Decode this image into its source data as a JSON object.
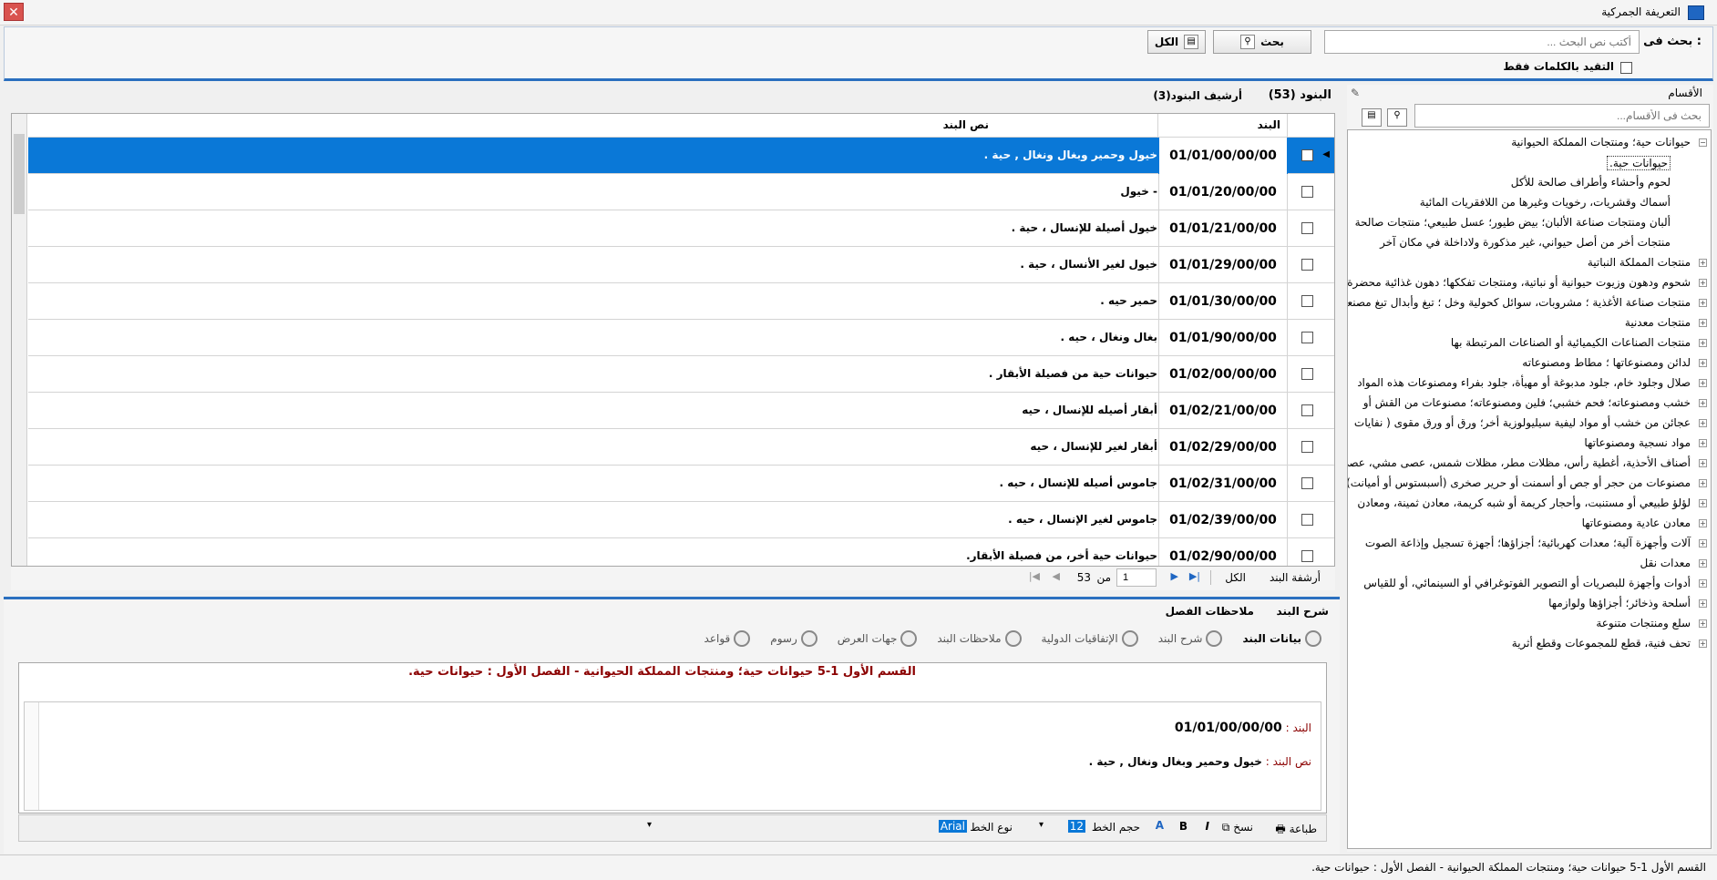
{
  "window": {
    "title": "التعريفة الجمركية",
    "close_label": "✕"
  },
  "search": {
    "label": "بحث فى :",
    "placeholder": "أكتب نص البحث ...",
    "search_btn": "بحث",
    "all_btn": "الكل",
    "exact_words_label": "التقيد بالكلمات فقط"
  },
  "categories": {
    "title": "الأقسام",
    "search_placeholder": "بحث فى الأقسام...",
    "items": [
      {
        "label": "حيوانات حية؛ ومنتجات المملكة الحيوانية",
        "expanded": true,
        "level": 0
      },
      {
        "label": "حيوانات حية.",
        "level": 1
      },
      {
        "label": "لحوم وأحشاء وأطراف صالحة للأكل",
        "level": 1
      },
      {
        "label": "أسماك وقشريات، رخويات وغيرها من اللافقريات المائية",
        "level": 1
      },
      {
        "label": "ألبان ومنتجات صناعة الألبان؛ بيض طيور؛ عسل طبيعي؛ منتجات صالحة",
        "level": 1
      },
      {
        "label": "منتجات أخر من أصل حيواني، غير مذكورة ولاداخلة في مكان آخر",
        "level": 1
      },
      {
        "label": "منتجات المملكة النباتية",
        "level": 0
      },
      {
        "label": "شحوم ودهون وزيوت حيوانية أو نباتية، ومنتجات تفككها؛ دهون غذائية محضرة",
        "level": 0
      },
      {
        "label": "منتجات صناعة الأغذية ؛ مشروبات، سوائل كحولية وخل ؛ تبغ وأبدال تبغ مصنعة",
        "level": 0
      },
      {
        "label": "منتجات معدنية",
        "level": 0
      },
      {
        "label": "منتجات الصناعات الكيميائية أو الصناعات المرتبطة بها",
        "level": 0
      },
      {
        "label": "لدائن ومصنوعاتها ؛ مطاط ومصنوعاته",
        "level": 0
      },
      {
        "label": "صلال وجلود خام، جلود مدبوغة أو مهيأة، جلود بفراء ومصنوعات هذه المواد",
        "level": 0
      },
      {
        "label": "خشب ومصنوعاته؛ فحم خشبي؛ فلين ومصنوعاته؛ مصنوعات من القش أو",
        "level": 0
      },
      {
        "label": "عجائن من خشب أو مواد ليفية سيليولوزية أخر؛ ورق أو ورق مقوى ( نفايات",
        "level": 0
      },
      {
        "label": "مواد نسجية ومصنوعاتها",
        "level": 0
      },
      {
        "label": "أصناف الأحذية، أغطية رأس، مظلات مطر، مظلات شمس، عصى مشي، عصى",
        "level": 0
      },
      {
        "label": "مصنوعات من حجر أو جص أو أسمنت أو حرير صخرى (أسبستوس أو أميانت)",
        "level": 0
      },
      {
        "label": "لؤلؤ طبيعي أو مستنبت، وأحجار كريمة أو شبه كريمة، معادن ثمينة، ومعادن",
        "level": 0
      },
      {
        "label": "معادن عادية ومصنوعاتها",
        "level": 0
      },
      {
        "label": "آلات وأجهزة آلية؛ معدات كهربائية؛ أجزاؤها؛ أجهزة تسجيل وإذاعة الصوت",
        "level": 0
      },
      {
        "label": "معدات نقل",
        "level": 0
      },
      {
        "label": "أدوات وأجهزة للبصريات أو التصوير الفوتوغرافي أو السينمائي، أو للقياس",
        "level": 0
      },
      {
        "label": "أسلحة وذخائر؛ أجزاؤها ولوازمها",
        "level": 0
      },
      {
        "label": "سلع ومنتجات متنوعة",
        "level": 0
      },
      {
        "label": "تحف فنية، قطع للمجموعات وقطع أثرية",
        "level": 0
      }
    ]
  },
  "tabs": {
    "items_tab": "البنود",
    "items_count": "(53)",
    "archive_tab": "أرشيف البنود(3)"
  },
  "grid": {
    "col_code": "البند",
    "col_text": "نص البند",
    "rows": [
      {
        "code": "01/01/00/00/00",
        "text": "خيول وحمير وبغال ونغال , حية ."
      },
      {
        "code": "01/01/20/00/00",
        "text": "- خيول"
      },
      {
        "code": "01/01/21/00/00",
        "text": "خيول أصيلة للإنسال ، حية ."
      },
      {
        "code": "01/01/29/00/00",
        "text": "خيول لغير الأنسال ، حية ."
      },
      {
        "code": "01/01/30/00/00",
        "text": "حمير حيه ."
      },
      {
        "code": "01/01/90/00/00",
        "text": "بغال ونغال ، حيه ."
      },
      {
        "code": "01/02/00/00/00",
        "text": "حيوانات حية من فصيلة الأبقار ."
      },
      {
        "code": "01/02/21/00/00",
        "text": "أبقار أصيله للإنسال ، حيه"
      },
      {
        "code": "01/02/29/00/00",
        "text": "أبقار  لغير  للإنسال ، حيه"
      },
      {
        "code": "01/02/31/00/00",
        "text": "جاموس أصيله  للإنسال ، حيه ."
      },
      {
        "code": "01/02/39/00/00",
        "text": "جاموس لغير  الإنسال ، حيه ."
      },
      {
        "code": "01/02/90/00/00",
        "text": "حيوانات حية أخر، من فصيلة الأبقار."
      }
    ]
  },
  "pager": {
    "current": "1",
    "of": "من",
    "total": "53",
    "all": "الكل",
    "archive": "أرشفة البند"
  },
  "details": {
    "tab_explain": "شرح البند",
    "tab_notes": "ملاحظات الفصل",
    "subtabs": [
      "بيانات البند",
      "شرح البند",
      "الإتفاقيات الدولية",
      "ملاحظات البند",
      "جهات العرض",
      "رسوم",
      "قواعد"
    ],
    "heading": "القسم الأول 1-5  حيوانات حية؛ ومنتجات المملكة الحيوانية - الفصل الأول : حيوانات حية.",
    "code_label": "البند :",
    "code_value": "01/01/00/00/00",
    "text_label": "نص البند :",
    "text_value": "خيول وحمير وبغال ونغال , حية ."
  },
  "editor_toolbar": {
    "print": "طباعة",
    "copy": "نسخ",
    "bold": "B",
    "italic": "I",
    "font_size_label": "حجم الخط",
    "font_size": "12",
    "font_type_label": "نوع الخط",
    "font_name": "Arial"
  },
  "status_bar": "القسم الأول 1-5  حيوانات حية؛ ومنتجات المملكة الحيوانية - الفصل الأول : حيوانات حية.",
  "colors": {
    "accent": "#2a6fbf",
    "selection": "#0a78d7",
    "maroon": "#8b0000"
  }
}
